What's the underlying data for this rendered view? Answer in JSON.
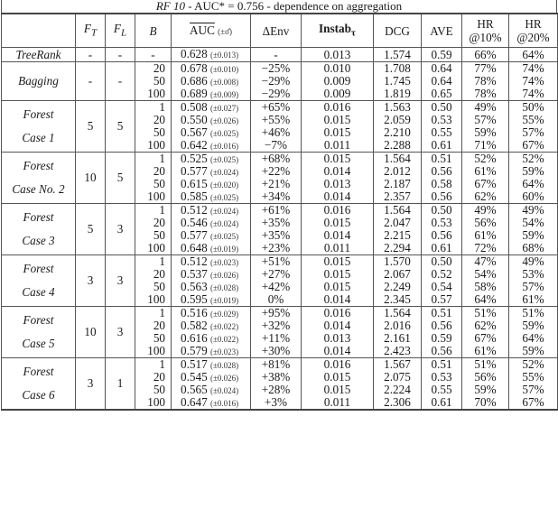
{
  "title": {
    "prefix": "RF 10",
    "rest": " - AUC* = 0.756 - dependence on aggregation"
  },
  "headers": {
    "method": "",
    "ft": "F",
    "ft_sub": "T",
    "fl": "F",
    "fl_sub": "L",
    "b": "B",
    "auc": "AUC",
    "auc_sub": "(±σ̂)",
    "env": "ΔEnv",
    "instab": "Instab",
    "instab_sub": "τ",
    "dcg": "DCG",
    "ave": "AVE",
    "hr10_line1": "HR",
    "hr10_line2": "@10%",
    "hr20_line1": "HR",
    "hr20_line2": "@20%"
  },
  "treerank": {
    "method": "TreeRank",
    "ft": "-",
    "fl": "-",
    "b": "-",
    "auc": "0.628",
    "auc_sd": "(±0.013)",
    "env": "-",
    "instab": "0.013",
    "dcg": "1.574",
    "ave": "0.59",
    "hr10": "66%",
    "hr20": "64%"
  },
  "groups": [
    {
      "method_line1": "Bagging",
      "method_line2": "",
      "ft": "-",
      "fl": "-",
      "rows": [
        {
          "b": "20",
          "auc": "0.678",
          "auc_sd": "(±0.010)",
          "env": "−25%",
          "instab": "0.010",
          "dcg": "1.708",
          "ave": "0.64",
          "hr10": "77%",
          "hr20": "74%"
        },
        {
          "b": "50",
          "auc": "0.686",
          "auc_sd": "(±0.008)",
          "env": "−29%",
          "instab": "0.009",
          "dcg": "1.745",
          "ave": "0.64",
          "hr10": "78%",
          "hr20": "74%"
        },
        {
          "b": "100",
          "auc": "0.689",
          "auc_sd": "(±0.009)",
          "env": "−29%",
          "instab": "0.009",
          "dcg": "1.819",
          "ave": "0.65",
          "hr10": "78%",
          "hr20": "74%"
        }
      ]
    },
    {
      "method_line1": "Forest",
      "method_line2": "Case 1",
      "ft": "5",
      "fl": "5",
      "rows": [
        {
          "b": "1",
          "auc": "0.508",
          "auc_sd": "(±0.027)",
          "env": "+65%",
          "instab": "0.016",
          "dcg": "1.563",
          "ave": "0.50",
          "hr10": "49%",
          "hr20": "50%"
        },
        {
          "b": "20",
          "auc": "0.550",
          "auc_sd": "(±0.026)",
          "env": "+55%",
          "instab": "0.015",
          "dcg": "2.059",
          "ave": "0.53",
          "hr10": "57%",
          "hr20": "55%"
        },
        {
          "b": "50",
          "auc": "0.567",
          "auc_sd": "(±0.025)",
          "env": "+46%",
          "instab": "0.015",
          "dcg": "2.210",
          "ave": "0.55",
          "hr10": "59%",
          "hr20": "57%"
        },
        {
          "b": "100",
          "auc": "0.642",
          "auc_sd": "(±0.016)",
          "env": "−7%",
          "instab": "0.011",
          "dcg": "2.288",
          "ave": "0.61",
          "hr10": "71%",
          "hr20": "67%"
        }
      ]
    },
    {
      "method_line1": "Forest",
      "method_line2": "Case No. 2",
      "ft": "10",
      "fl": "5",
      "rows": [
        {
          "b": "1",
          "auc": "0.525",
          "auc_sd": "(±0.025)",
          "env": "+68%",
          "instab": "0.015",
          "dcg": "1.564",
          "ave": "0.51",
          "hr10": "52%",
          "hr20": "52%"
        },
        {
          "b": "20",
          "auc": "0.577",
          "auc_sd": "(±0.024)",
          "env": "+22%",
          "instab": "0.014",
          "dcg": "2.012",
          "ave": "0.56",
          "hr10": "61%",
          "hr20": "59%"
        },
        {
          "b": "50",
          "auc": "0.615",
          "auc_sd": "(±0.020)",
          "env": "+21%",
          "instab": "0.013",
          "dcg": "2.187",
          "ave": "0.58",
          "hr10": "67%",
          "hr20": "64%"
        },
        {
          "b": "100",
          "auc": "0.585",
          "auc_sd": "(±0.025)",
          "env": "+34%",
          "instab": "0.014",
          "dcg": "2.357",
          "ave": "0.56",
          "hr10": "62%",
          "hr20": "60%"
        }
      ]
    },
    {
      "method_line1": "Forest",
      "method_line2": "Case 3",
      "ft": "5",
      "fl": "3",
      "rows": [
        {
          "b": "1",
          "auc": "0.512",
          "auc_sd": "(±0.024)",
          "env": "+61%",
          "instab": "0.016",
          "dcg": "1.564",
          "ave": "0.50",
          "hr10": "49%",
          "hr20": "49%"
        },
        {
          "b": "20",
          "auc": "0.546",
          "auc_sd": "(±0.024)",
          "env": "+35%",
          "instab": "0.015",
          "dcg": "2.047",
          "ave": "0.53",
          "hr10": "56%",
          "hr20": "54%"
        },
        {
          "b": "50",
          "auc": "0.577",
          "auc_sd": "(±0.025)",
          "env": "+35%",
          "instab": "0.014",
          "dcg": "2.215",
          "ave": "0.56",
          "hr10": "61%",
          "hr20": "59%"
        },
        {
          "b": "100",
          "auc": "0.648",
          "auc_sd": "(±0.019)",
          "env": "+23%",
          "instab": "0.011",
          "dcg": "2.294",
          "ave": "0.61",
          "hr10": "72%",
          "hr20": "68%"
        }
      ]
    },
    {
      "method_line1": "Forest",
      "method_line2": "Case 4",
      "ft": "3",
      "fl": "3",
      "rows": [
        {
          "b": "1",
          "auc": "0.512",
          "auc_sd": "(±0.023)",
          "env": "+51%",
          "instab": "0.015",
          "dcg": "1.570",
          "ave": "0.50",
          "hr10": "47%",
          "hr20": "49%"
        },
        {
          "b": "20",
          "auc": "0.537",
          "auc_sd": "(±0.026)",
          "env": "+27%",
          "instab": "0.015",
          "dcg": "2.067",
          "ave": "0.52",
          "hr10": "54%",
          "hr20": "53%"
        },
        {
          "b": "50",
          "auc": "0.563",
          "auc_sd": "(±0.028)",
          "env": "+42%",
          "instab": "0.015",
          "dcg": "2.249",
          "ave": "0.54",
          "hr10": "58%",
          "hr20": "57%"
        },
        {
          "b": "100",
          "auc": "0.595",
          "auc_sd": "(±0.019)",
          "env": "0%",
          "instab": "0.014",
          "dcg": "2.345",
          "ave": "0.57",
          "hr10": "64%",
          "hr20": "61%"
        }
      ]
    },
    {
      "method_line1": "Forest",
      "method_line2": "Case 5",
      "ft": "10",
      "fl": "3",
      "rows": [
        {
          "b": "1",
          "auc": "0.516",
          "auc_sd": "(±0.029)",
          "env": "+95%",
          "instab": "0.016",
          "dcg": "1.564",
          "ave": "0.51",
          "hr10": "51%",
          "hr20": "51%"
        },
        {
          "b": "20",
          "auc": "0.582",
          "auc_sd": "(±0.022)",
          "env": "+32%",
          "instab": "0.014",
          "dcg": "2.016",
          "ave": "0.56",
          "hr10": "62%",
          "hr20": "59%"
        },
        {
          "b": "50",
          "auc": "0.616",
          "auc_sd": "(±0.022)",
          "env": "+11%",
          "instab": "0.013",
          "dcg": "2.161",
          "ave": "0.59",
          "hr10": "67%",
          "hr20": "64%"
        },
        {
          "b": "100",
          "auc": "0.579",
          "auc_sd": "(±0.023)",
          "env": "+30%",
          "instab": "0.014",
          "dcg": "2.423",
          "ave": "0.56",
          "hr10": "61%",
          "hr20": "59%"
        }
      ]
    },
    {
      "method_line1": "Forest",
      "method_line2": "Case 6",
      "ft": "3",
      "fl": "1",
      "rows": [
        {
          "b": "1",
          "auc": "0.517",
          "auc_sd": "(±0.028)",
          "env": "+81%",
          "instab": "0.016",
          "dcg": "1.567",
          "ave": "0.51",
          "hr10": "51%",
          "hr20": "52%"
        },
        {
          "b": "20",
          "auc": "0.545",
          "auc_sd": "(±0.026)",
          "env": "+38%",
          "instab": "0.015",
          "dcg": "2.075",
          "ave": "0.53",
          "hr10": "56%",
          "hr20": "55%"
        },
        {
          "b": "50",
          "auc": "0.565",
          "auc_sd": "(±0.024)",
          "env": "+28%",
          "instab": "0.015",
          "dcg": "2.224",
          "ave": "0.55",
          "hr10": "59%",
          "hr20": "57%"
        },
        {
          "b": "100",
          "auc": "0.647",
          "auc_sd": "(±0.016)",
          "env": "+3%",
          "instab": "0.011",
          "dcg": "2.306",
          "ave": "0.61",
          "hr10": "70%",
          "hr20": "67%"
        }
      ]
    }
  ]
}
